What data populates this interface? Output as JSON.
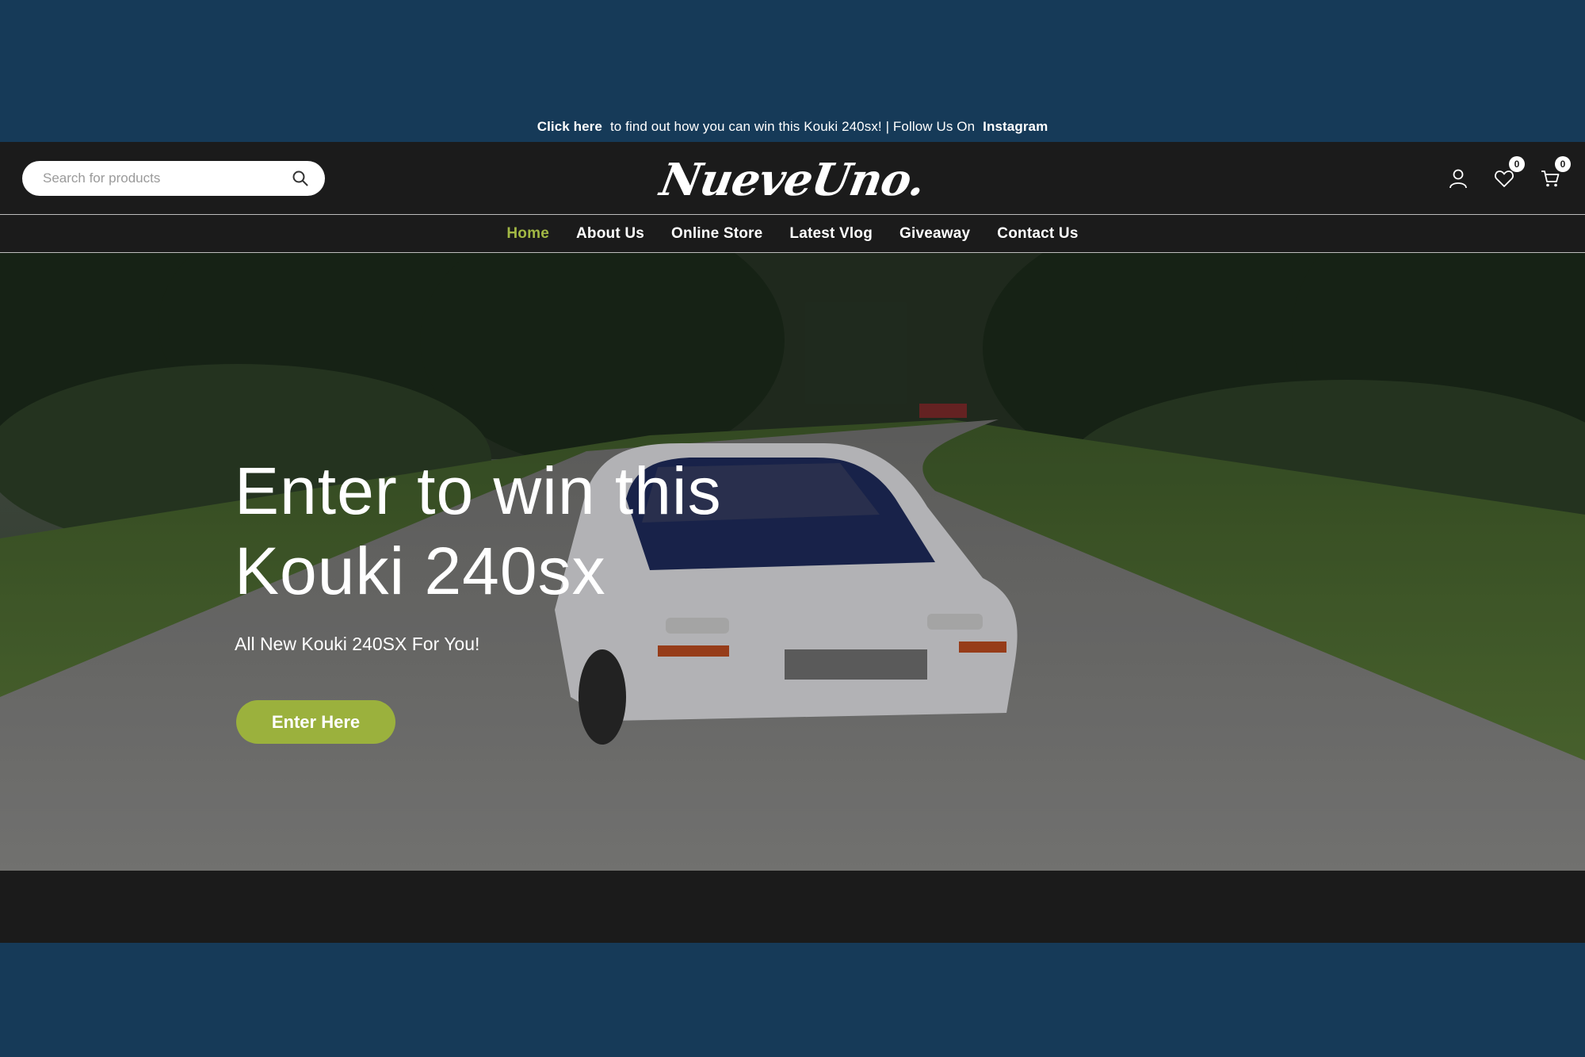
{
  "announcement": {
    "link_label": "Click here",
    "text": "to find out how you can win this Kouki 240sx! | Follow Us On",
    "social_label": "Instagram"
  },
  "header": {
    "search_placeholder": "Search for products",
    "logo_text": "NueveUno.",
    "wishlist_count": "0",
    "cart_count": "0"
  },
  "nav": {
    "items": [
      {
        "label": "Home",
        "active": true
      },
      {
        "label": "About Us"
      },
      {
        "label": "Online Store"
      },
      {
        "label": "Latest Vlog"
      },
      {
        "label": "Giveaway"
      },
      {
        "label": "Contact Us"
      }
    ]
  },
  "hero": {
    "title_line1": "Enter to win this",
    "title_line2": "Kouki 240sx",
    "subtitle": "All New Kouki 240SX For You!",
    "button_label": "Enter Here"
  },
  "colors": {
    "page_background": "#163a58",
    "header_background": "#1b1b1b",
    "accent": "#9bb13d",
    "nav_active": "#a2b844"
  },
  "icons": [
    "search-icon",
    "user-icon",
    "heart-icon",
    "cart-icon"
  ]
}
